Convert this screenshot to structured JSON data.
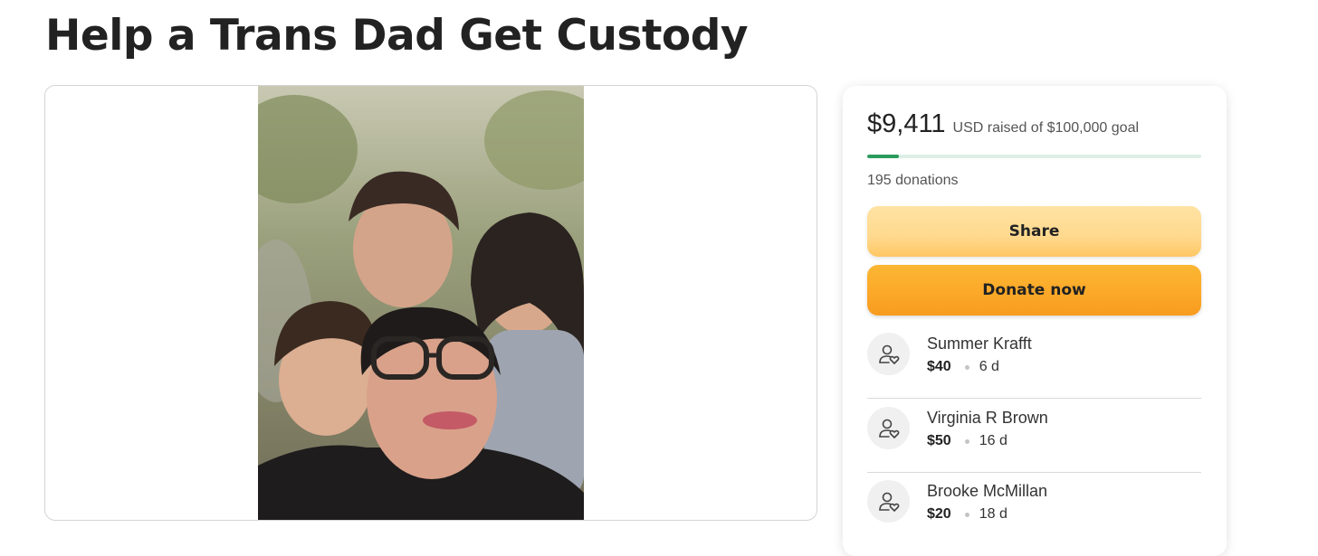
{
  "page": {
    "title": "Help a Trans Dad Get Custody"
  },
  "media": {
    "icon": "campaign-photo"
  },
  "fundraiser": {
    "raised_amount": "$9,411",
    "raised_text": "USD raised of $100,000 goal",
    "progress_fraction": 0.094,
    "donation_count": "195 donations",
    "share_label": "Share",
    "donate_label": "Donate now"
  },
  "donors": [
    {
      "name": "Summer Krafft",
      "amount": "$40",
      "time": "6 d",
      "icon": "donor-heart-icon"
    },
    {
      "name": "Virginia R Brown",
      "amount": "$50",
      "time": "16 d",
      "icon": "donor-heart-icon"
    },
    {
      "name": "Brooke McMillan",
      "amount": "$20",
      "time": "18 d",
      "icon": "donor-heart-icon"
    }
  ],
  "colors": {
    "progress": "#2a9b5d",
    "share_button": "#ffd98e",
    "donate_button": "#fca728"
  }
}
